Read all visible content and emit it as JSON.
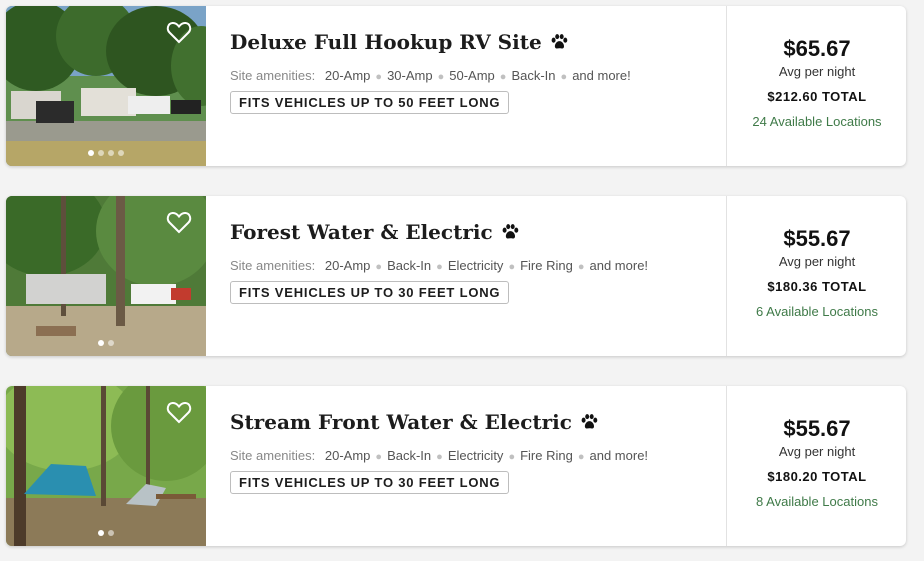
{
  "listings": [
    {
      "title": "Deluxe Full Hookup RV Site",
      "amenities_label": "Site amenities:",
      "amenities": [
        "20-Amp",
        "30-Amp",
        "50-Amp",
        "Back-In",
        "and more!"
      ],
      "fits": "FITS VEHICLES UP TO 50 FEET LONG",
      "price": "$65.67",
      "avg_label": "Avg per night",
      "total": "$212.60 TOTAL",
      "locations": "24 Available Locations",
      "photo_count": 4
    },
    {
      "title": "Forest Water & Electric",
      "amenities_label": "Site amenities:",
      "amenities": [
        "20-Amp",
        "Back-In",
        "Electricity",
        "Fire Ring",
        "and more!"
      ],
      "fits": "FITS VEHICLES UP TO 30 FEET LONG",
      "price": "$55.67",
      "avg_label": "Avg per night",
      "total": "$180.36 TOTAL",
      "locations": "6 Available Locations",
      "photo_count": 2
    },
    {
      "title": "Stream Front Water & Electric",
      "amenities_label": "Site amenities:",
      "amenities": [
        "20-Amp",
        "Back-In",
        "Electricity",
        "Fire Ring",
        "and more!"
      ],
      "fits": "FITS VEHICLES UP TO 30 FEET LONG",
      "price": "$55.67",
      "avg_label": "Avg per night",
      "total": "$180.20 TOTAL",
      "locations": "8 Available Locations",
      "photo_count": 2
    }
  ],
  "icons": {
    "favorite": "heart-outline-icon",
    "pets": "paw-icon"
  },
  "colors": {
    "location_link": "#3f7a48",
    "text": "#1c1c1c"
  }
}
